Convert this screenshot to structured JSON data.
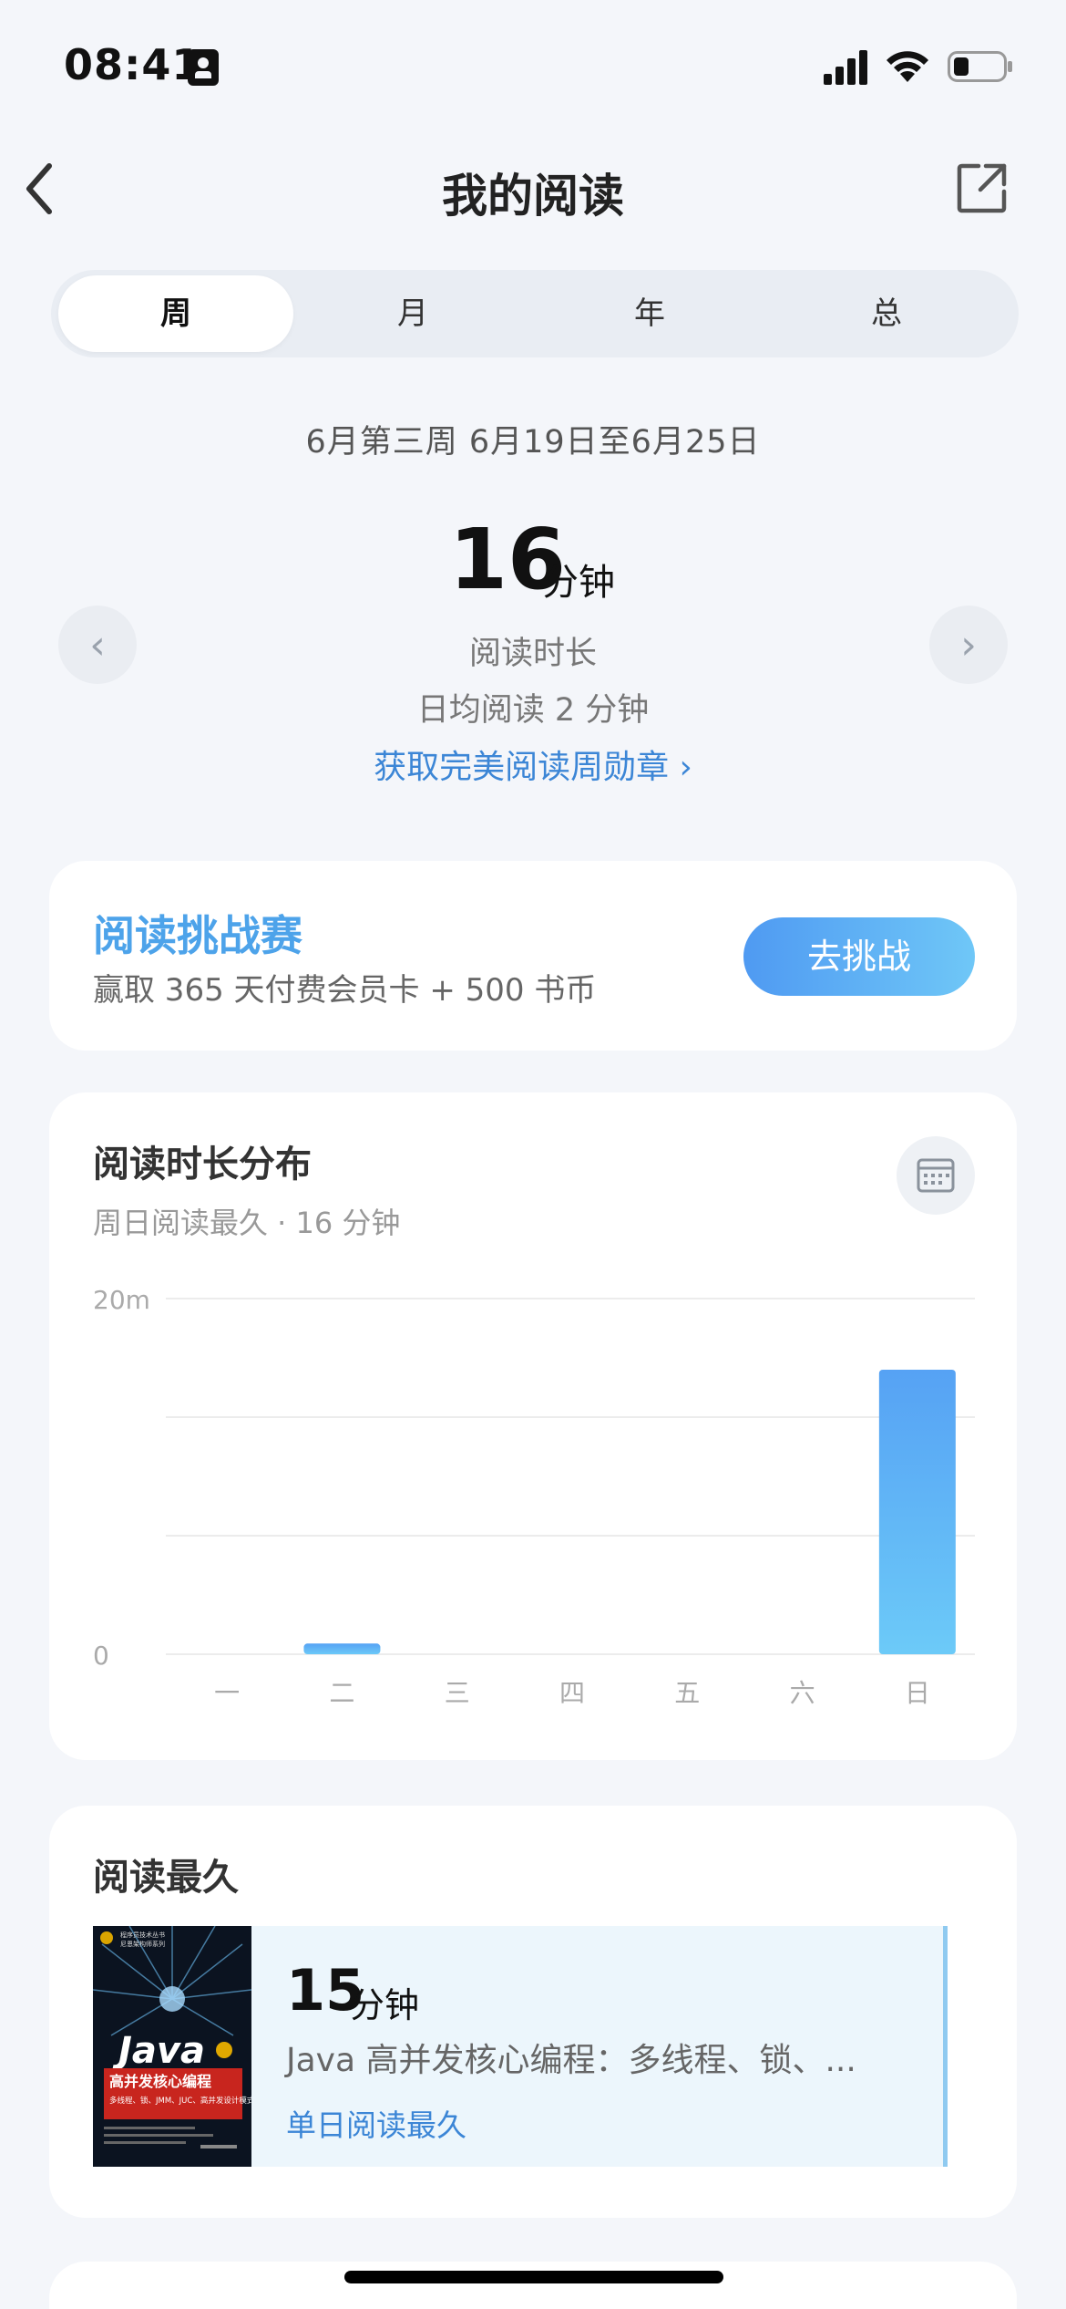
{
  "status_bar": {
    "time": "08:41"
  },
  "nav": {
    "title": "我的阅读"
  },
  "tabs": [
    {
      "label": "周",
      "active": true
    },
    {
      "label": "月",
      "active": false
    },
    {
      "label": "年",
      "active": false
    },
    {
      "label": "总",
      "active": false
    }
  ],
  "summary": {
    "date_range": "6月第三周 6月19日至6月25日",
    "total_value": "16",
    "total_unit": "分钟",
    "total_label": "阅读时长",
    "daily_avg": "日均阅读 2 分钟",
    "medal_link": "获取完美阅读周勋章 ›"
  },
  "challenge": {
    "title": "阅读挑战赛",
    "subtitle": "赢取 365 天付费会员卡 + 500 书币",
    "button": "去挑战"
  },
  "distribution": {
    "title": "阅读时长分布",
    "subtitle": "周日阅读最久 · 16 分钟"
  },
  "chart_data": {
    "type": "bar",
    "categories": [
      "一",
      "二",
      "三",
      "四",
      "五",
      "六",
      "日"
    ],
    "values": [
      0,
      0.6,
      0,
      0,
      0,
      0,
      16
    ],
    "ylim": [
      0,
      20
    ],
    "y_tick_labels": [
      "0",
      "20m"
    ],
    "grid": true,
    "colors": {
      "bar_top": "#56a2f4",
      "bar_bottom": "#6ccaf8"
    }
  },
  "longest": {
    "title": "阅读最久",
    "minutes_value": "15",
    "minutes_unit": "分钟",
    "book_name": "Java 高并发核心编程：多线程、锁、...",
    "tag": "单日阅读最久",
    "cover_text": {
      "brand": "Java",
      "title": "高并发核心编程",
      "subtitle": "多线程、锁、JMM、JUC、高并发设计模式"
    }
  },
  "colors": {
    "accent": "#3c86d6",
    "challenge_title": "#4da3ea",
    "background": "#f4f6fa"
  }
}
